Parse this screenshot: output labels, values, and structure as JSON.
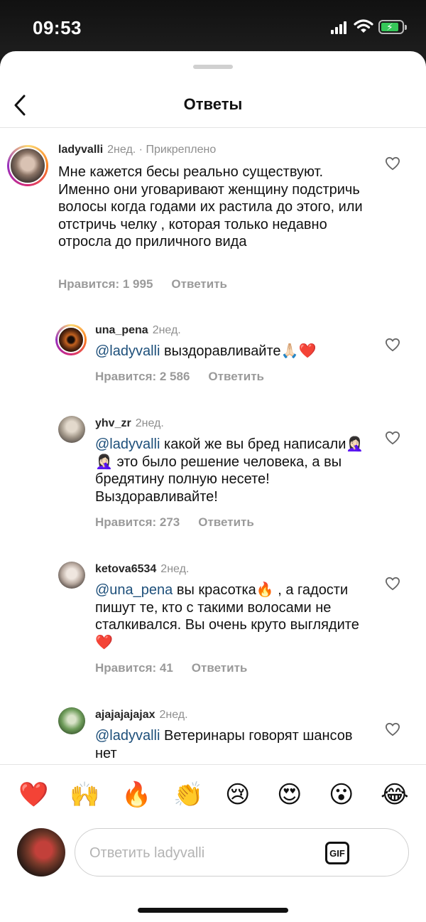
{
  "status": {
    "time": "09:53"
  },
  "header": {
    "title": "Ответы"
  },
  "parent": {
    "user": "ladyvalli",
    "age": "2нед.",
    "pinned": "· Прикреплено",
    "text": "Мне кажется бесы реально существуют. Именно они уговаривают женщину подстричь волосы когда годами их растила до этого, или отстричь челку , которая только недавно отросла до приличного вида",
    "likes": "Нравится: 1 995",
    "reply": "Ответить"
  },
  "replies": [
    {
      "user": "una_pena",
      "age": "2нед.",
      "mention": "@ladyvalli",
      "text": " выздоравливайте🙏🏻❤️",
      "likes": "Нравится: 2 586",
      "reply": "Ответить"
    },
    {
      "user": "yhv_zr",
      "age": "2нед.",
      "mention": "@ladyvalli",
      "text": " какой же вы бред написали🤦🏻‍♀️🤦🏻‍♀️ это было решение человека, а вы бредятину полную несете! Выздоравливайте!",
      "likes": "Нравится: 273",
      "reply": "Ответить"
    },
    {
      "user": "ketova6534",
      "age": "2нед.",
      "mention": "@una_pena",
      "text": " вы красотка🔥 , а гадости пишут те, кто с такими волосами не сталкивался.  Вы очень круто выглядите❤️",
      "likes": "Нравится: 41",
      "reply": "Ответить"
    },
    {
      "user": "ajajajajajax",
      "age": "2нед.",
      "mention": "@ladyvalli",
      "text": " Ветеринары говорят шансов нет"
    }
  ],
  "emojis": [
    "❤️",
    "🙌",
    "🔥",
    "👏",
    "😢",
    "😍",
    "😮",
    "😂"
  ],
  "composer": {
    "placeholder": "Ответить ladyvalli",
    "gif": "GIF"
  },
  "icons": {
    "back": "chevron-left-icon",
    "like": "heart-outline-icon"
  },
  "colors": {
    "mention": "#1d4f7a",
    "muted": "#8e8e8e"
  }
}
